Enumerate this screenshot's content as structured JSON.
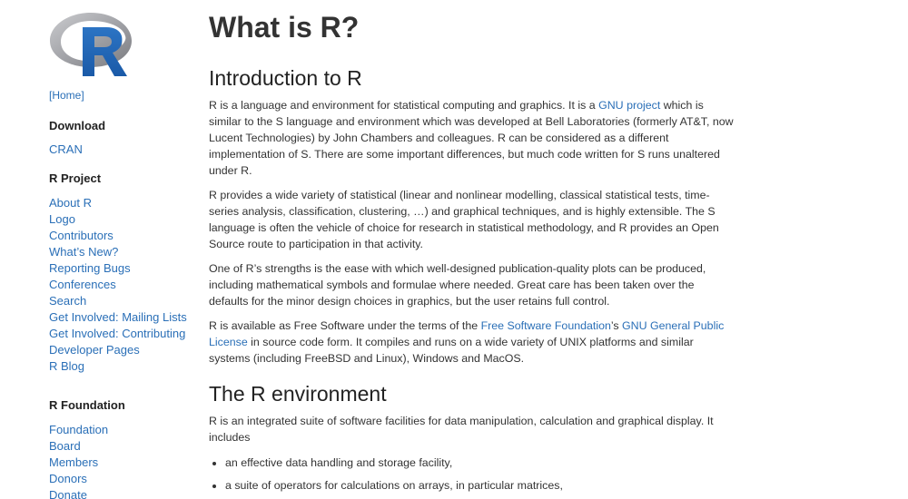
{
  "sidebar": {
    "home_label": "[Home]",
    "download": {
      "heading": "Download",
      "items": [
        "CRAN"
      ]
    },
    "project": {
      "heading": "R Project",
      "items": [
        "About R",
        "Logo",
        "Contributors",
        "What’s New?",
        "Reporting Bugs",
        "Conferences",
        "Search",
        "Get Involved: Mailing Lists",
        "Get Involved: Contributing",
        "Developer Pages",
        "R Blog"
      ]
    },
    "foundation": {
      "heading": "R Foundation",
      "items": [
        "Foundation",
        "Board",
        "Members",
        "Donors",
        "Donate"
      ]
    }
  },
  "main": {
    "title": "What is R?",
    "intro": {
      "heading": "Introduction to R",
      "p1_a": "R is a language and environment for statistical computing and graphics. It is a ",
      "p1_link": "GNU project",
      "p1_b": " which is similar to the S language and environment which was developed at Bell Laboratories (formerly AT&T, now Lucent Technologies) by John Chambers and colleagues. R can be considered as a different implementation of S. There are some important differences, but much code written for S runs unaltered under R.",
      "p2": "R provides a wide variety of statistical (linear and nonlinear modelling, classical statistical tests, time-series analysis, classification, clustering, …) and graphical techniques, and is highly extensible. The S language is often the vehicle of choice for research in statistical methodology, and R provides an Open Source route to participation in that activity.",
      "p3": "One of R’s strengths is the ease with which well-designed publication-quality plots can be produced, including mathematical symbols and formulae where needed. Great care has been taken over the defaults for the minor design choices in graphics, but the user retains full control.",
      "p4_a": "R is available as Free Software under the terms of the ",
      "p4_link1": "Free Software Foundation",
      "p4_b": "’s ",
      "p4_link2": "GNU General Public License",
      "p4_c": " in source code form. It compiles and runs on a wide variety of UNIX platforms and similar systems (including FreeBSD and Linux), Windows and MacOS."
    },
    "environment": {
      "heading": "The R environment",
      "p1": "R is an integrated suite of software facilities for data manipulation, calculation and graphical display. It includes",
      "bullets": [
        "an effective data handling and storage facility,",
        "a suite of operators for calculations on arrays, in particular matrices,"
      ]
    }
  },
  "colors": {
    "link": "#2a6fb7",
    "text": "#333333",
    "logo_ring": "#a8a9ad",
    "logo_letter": "#2166b8"
  }
}
